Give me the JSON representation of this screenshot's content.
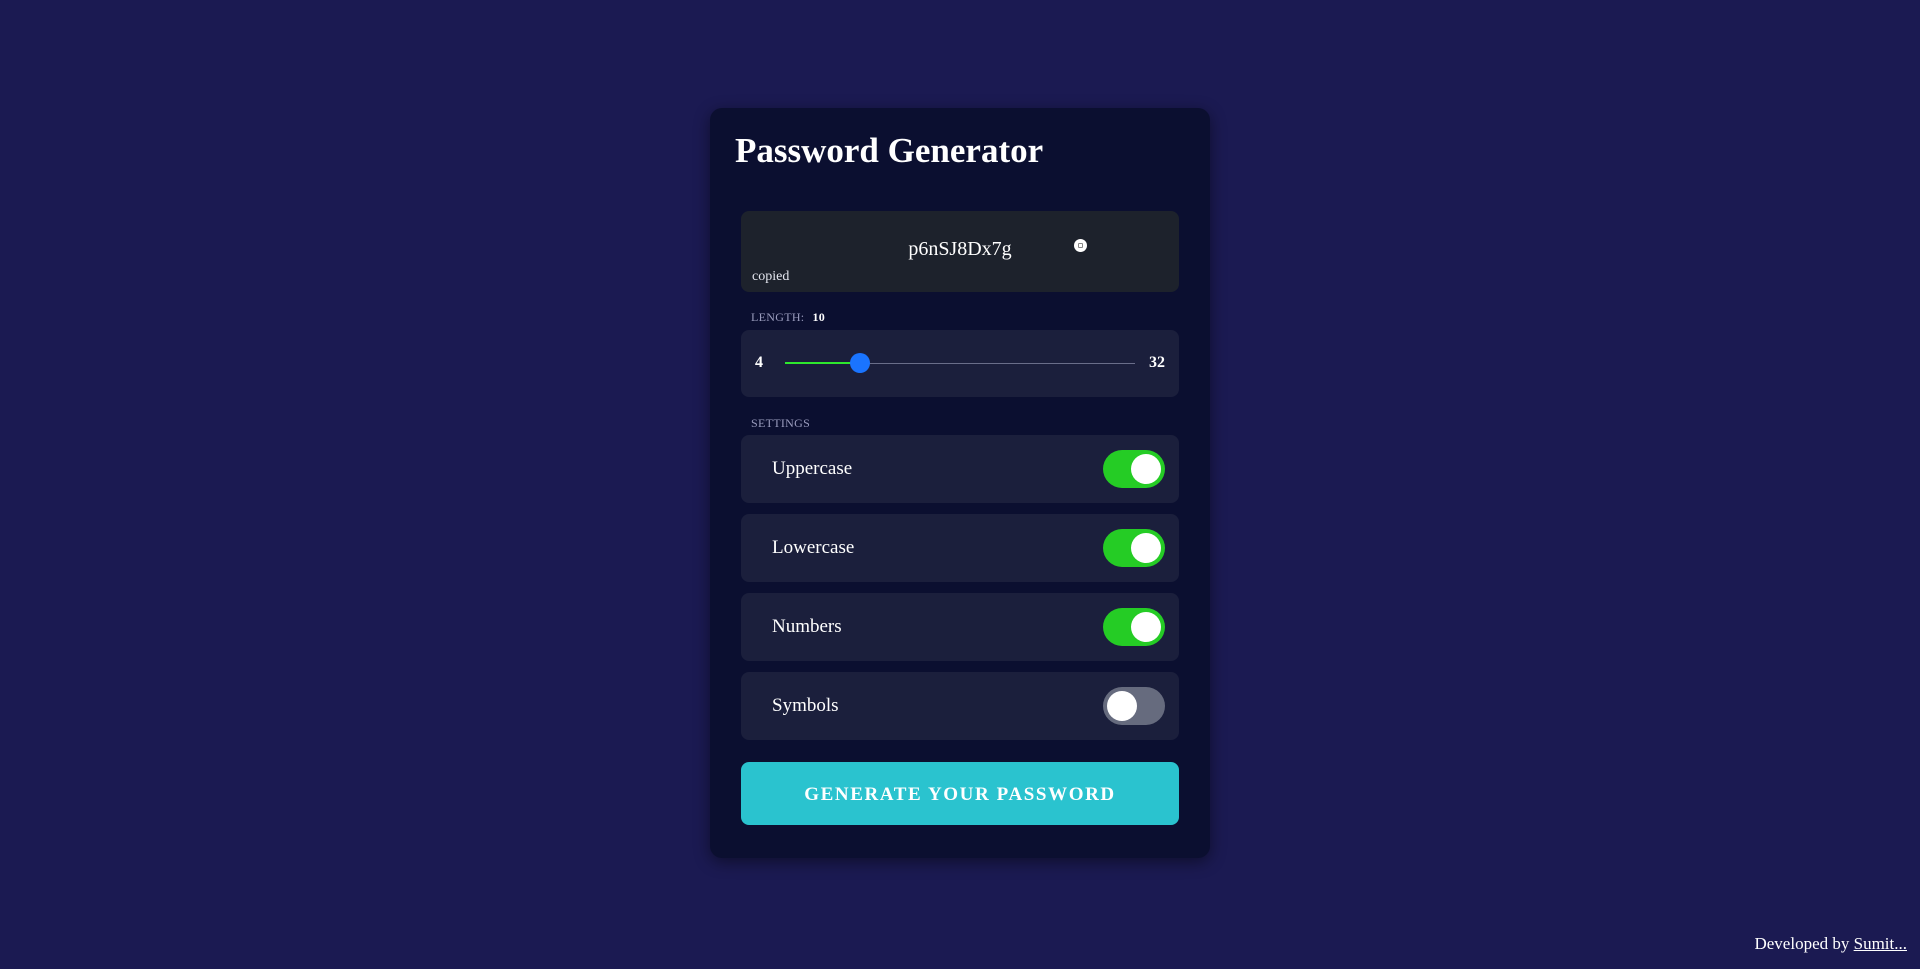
{
  "app": {
    "title": "Password Generator"
  },
  "result": {
    "password": "p6nSJ8Dx7g",
    "copy_icon": "clipboard-icon",
    "status": "copied"
  },
  "length": {
    "label": "LENGTH:",
    "value": "10",
    "min": "4",
    "max": "32",
    "fill_fraction": 0.214
  },
  "settings": {
    "label": "SETTINGS",
    "items": [
      {
        "label": "Uppercase",
        "enabled": true
      },
      {
        "label": "Lowercase",
        "enabled": true
      },
      {
        "label": "Numbers",
        "enabled": true
      },
      {
        "label": "Symbols",
        "enabled": false
      }
    ]
  },
  "generate": {
    "label": "GENERATE YOUR PASSWORD"
  },
  "footer": {
    "prefix": "Developed by",
    "link": "Sumit..."
  },
  "colors": {
    "background": "#1b1a52",
    "card": "#0b0f30",
    "toggle_on": "#25cc25",
    "toggle_off": "#666b7e",
    "slider_thumb": "#1a74ff",
    "slider_fill": "#2ee82e",
    "button": "#2ac3cf"
  }
}
